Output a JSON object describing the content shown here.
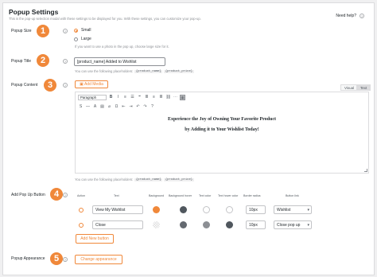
{
  "header": {
    "title": "Popup Settings",
    "subtitle": "This is the pop-up selection modal with these settings to be displayed for you. With these settings, you can customize your pop-up.",
    "need_help": "Need help?"
  },
  "badges": [
    "1",
    "2",
    "3",
    "4",
    "5"
  ],
  "popup_size": {
    "label": "Popup Size",
    "options": [
      "Small",
      "Large"
    ],
    "selected": "Small",
    "hint": "If you want to use a photo in the pop up, choose large size for it."
  },
  "popup_title": {
    "label": "Popup Title",
    "value": "[product_name] Added to Wishlist",
    "hint": "You can use the following placeholders:",
    "placeholders": [
      "{product_name}",
      "{product_price}"
    ]
  },
  "popup_content": {
    "label": "Popup Content",
    "add_media": "Add Media",
    "tabs": [
      "Visual",
      "Text"
    ],
    "active_tab": "Text",
    "format_select": "Paragraph",
    "line1": "Experience the Joy of Owning Your Favorite Product",
    "line2": "by Adding it to Your Wishlist Today!",
    "hint": "You can use the following placeholders:",
    "placeholders": [
      "{product_name}",
      "{product_price}"
    ]
  },
  "popup_buttons": {
    "label": "Add Pop Up Button",
    "columns": [
      "Action",
      "Text",
      "Background",
      "Background hover",
      "Text color",
      "Text hover color",
      "Border radius",
      "Button link"
    ],
    "rows": [
      {
        "text": "View My Wishlist",
        "radius": "10px",
        "link": "Wishlist",
        "bg": "#f0883a",
        "bg_hover": "#50575e",
        "text_color": "#ffffff",
        "text_hover": "#ffffff"
      },
      {
        "text": "Close",
        "radius": "10px",
        "link": "Close pop up",
        "bg": "transparent",
        "bg_hover": "#646970",
        "text_color": "#8c8f94",
        "text_hover": "#50575e"
      }
    ],
    "add_button": "Add New button"
  },
  "popup_appearance": {
    "label": "Popup Appearance",
    "button": "Change appearance"
  },
  "colors": {
    "accent": "#f0883a",
    "border": "#dcdcde",
    "text": "#1d2327",
    "muted": "#8c8f94"
  },
  "icons": [
    "help-icon",
    "add-media-icon",
    "bold-icon",
    "italic-icon",
    "underline-icon",
    "link-icon",
    "undo-icon",
    "redo-icon",
    "resize-icon"
  ]
}
